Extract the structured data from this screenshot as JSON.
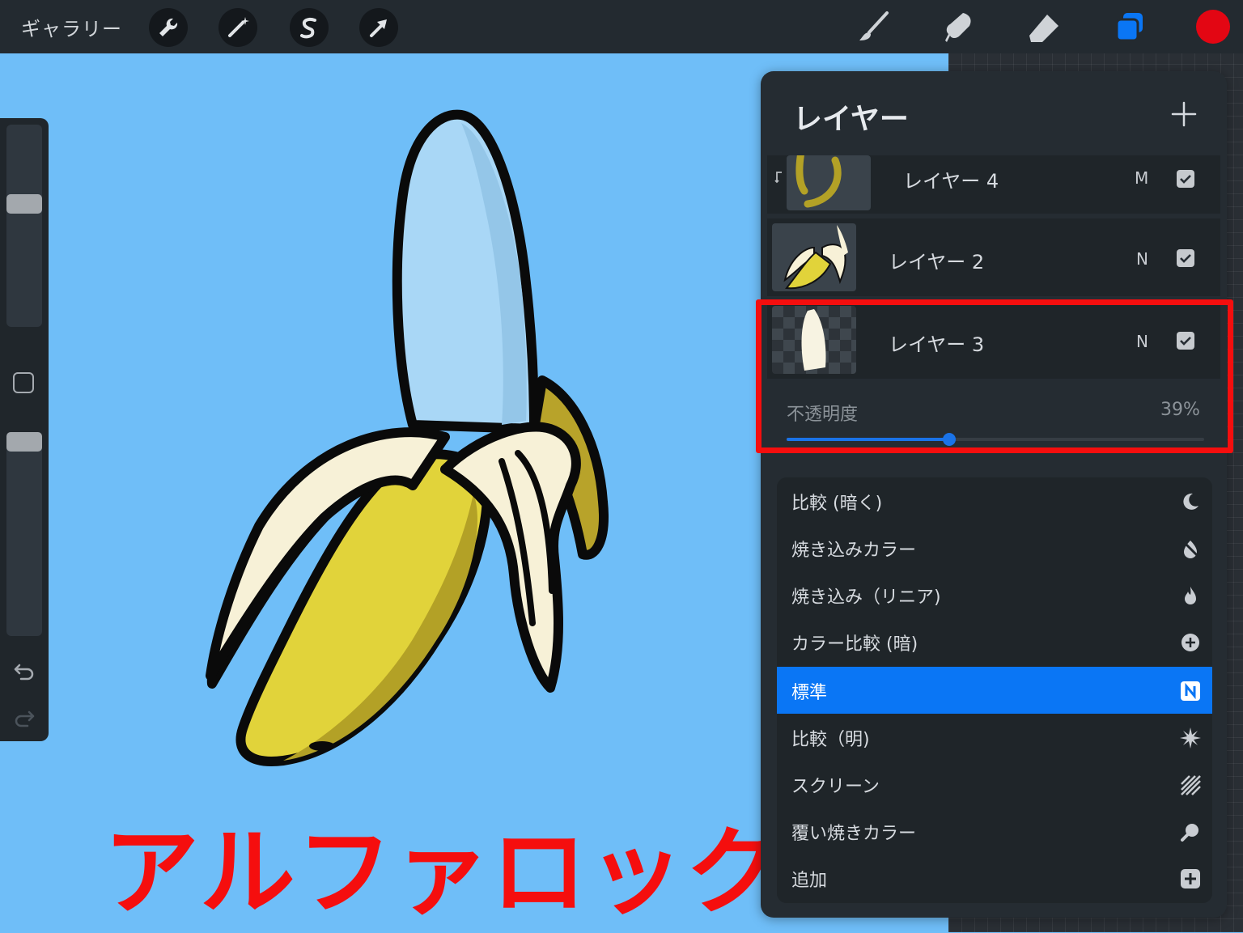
{
  "toolbar": {
    "gallery_label": "ギャラリー",
    "left_tools": [
      "wrench-icon",
      "magic-wand-icon",
      "selection-s-icon",
      "transform-arrow-icon"
    ],
    "right_tools": [
      "brush-icon",
      "smudge-icon",
      "eraser-icon",
      "layers-icon"
    ],
    "current_color": "#e30613"
  },
  "sidebar": {
    "brush_size_level": 0.62,
    "opacity_level": 1.0,
    "undo": "undo-icon",
    "redo": "redo-icon"
  },
  "canvas": {
    "background_color": "#6fbef8",
    "overlay_text": "アルファロック",
    "overlay_text_color": "#f50e0e"
  },
  "layers_panel": {
    "title": "レイヤー",
    "add_icon": "plus-icon",
    "layers": [
      {
        "name": "レイヤー 4",
        "mode": "M",
        "visible": true,
        "clipped": true
      },
      {
        "name": "レイヤー 2",
        "mode": "N",
        "visible": true,
        "clipped": false
      },
      {
        "name": "レイヤー 3",
        "mode": "N",
        "visible": true,
        "clipped": false,
        "selected": true
      }
    ],
    "opacity_label": "不透明度",
    "opacity_value": "39%",
    "opacity_fraction": 0.39
  },
  "blend_modes": {
    "items": [
      {
        "label": "比較 (暗く)",
        "icon": "moon-icon"
      },
      {
        "label": "焼き込みカラー",
        "icon": "burn-slash-icon"
      },
      {
        "label": "焼き込み（リニア)",
        "icon": "flame-icon"
      },
      {
        "label": "カラー比較 (暗)",
        "icon": "plus-circle-icon"
      },
      {
        "label": "標準",
        "icon": "n-badge-icon",
        "selected": true
      },
      {
        "label": "比較（明)",
        "icon": "sunburst-icon"
      },
      {
        "label": "スクリーン",
        "icon": "stripes-icon"
      },
      {
        "label": "覆い焼きカラー",
        "icon": "magnifier-icon"
      },
      {
        "label": "追加",
        "icon": "plus-square-icon"
      }
    ],
    "selected_color": "#0a76f5"
  }
}
